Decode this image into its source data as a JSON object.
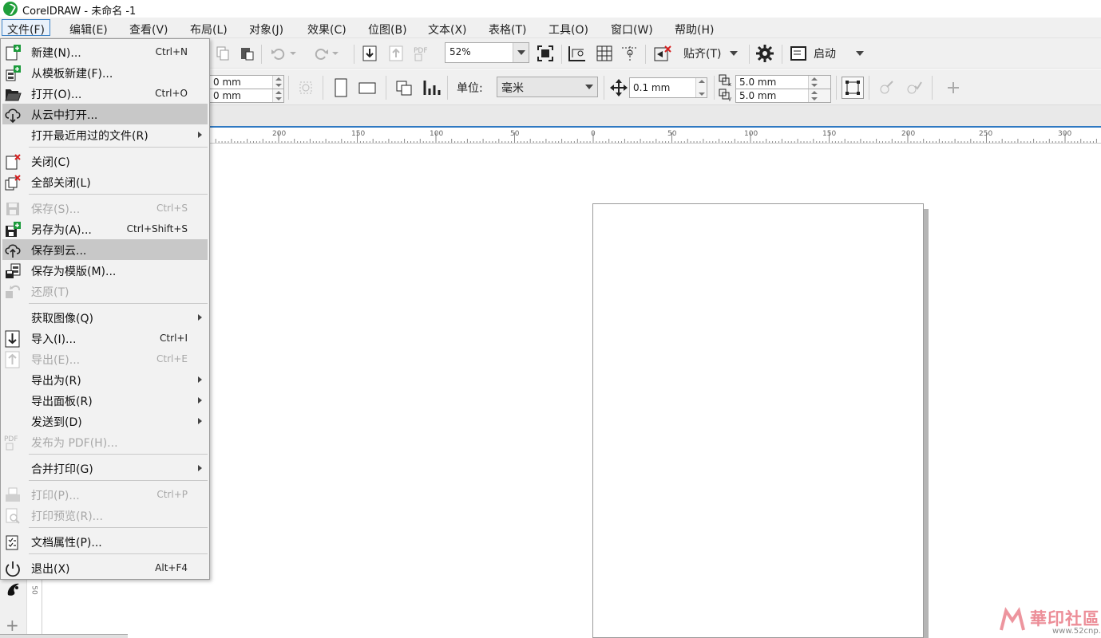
{
  "window": {
    "title": "CorelDRAW - 未命名 -1"
  },
  "menubar": {
    "items": [
      {
        "label": "文件(F)"
      },
      {
        "label": "编辑(E)"
      },
      {
        "label": "查看(V)"
      },
      {
        "label": "布局(L)"
      },
      {
        "label": "对象(J)"
      },
      {
        "label": "效果(C)"
      },
      {
        "label": "位图(B)"
      },
      {
        "label": "文本(X)"
      },
      {
        "label": "表格(T)"
      },
      {
        "label": "工具(O)"
      },
      {
        "label": "窗口(W)"
      },
      {
        "label": "帮助(H)"
      }
    ],
    "open_menu": "文件(F)"
  },
  "file_menu": {
    "items": [
      {
        "label": "新建(N)...",
        "shortcut": "Ctrl+N",
        "icon": "new-document-icon",
        "enabled": true
      },
      {
        "label": "从模板新建(F)...",
        "shortcut": "",
        "icon": "new-from-template-icon",
        "enabled": true
      },
      {
        "label": "打开(O)...",
        "shortcut": "Ctrl+O",
        "icon": "open-folder-icon",
        "enabled": true
      },
      {
        "label": "从云中打开...",
        "shortcut": "",
        "icon": "cloud-download-icon",
        "enabled": true,
        "highlighted": true
      },
      {
        "label": "打开最近用过的文件(R)",
        "shortcut": "",
        "icon": "",
        "enabled": true,
        "submenu": true
      },
      {
        "label": "关闭(C)",
        "shortcut": "",
        "icon": "close-document-icon",
        "enabled": true
      },
      {
        "label": "全部关闭(L)",
        "shortcut": "",
        "icon": "close-all-icon",
        "enabled": true
      },
      {
        "label": "保存(S)...",
        "shortcut": "Ctrl+S",
        "icon": "save-icon",
        "enabled": false
      },
      {
        "label": "另存为(A)...",
        "shortcut": "Ctrl+Shift+S",
        "icon": "save-as-icon",
        "enabled": true
      },
      {
        "label": "保存到云...",
        "shortcut": "",
        "icon": "cloud-upload-icon",
        "enabled": true,
        "highlighted": true
      },
      {
        "label": "保存为模版(M)...",
        "shortcut": "",
        "icon": "save-as-template-icon",
        "enabled": true
      },
      {
        "label": "还原(T)",
        "shortcut": "",
        "icon": "revert-icon",
        "enabled": false
      },
      {
        "label": "获取图像(Q)",
        "shortcut": "",
        "icon": "",
        "enabled": true,
        "submenu": true
      },
      {
        "label": "导入(I)...",
        "shortcut": "Ctrl+I",
        "icon": "import-icon",
        "enabled": true
      },
      {
        "label": "导出(E)...",
        "shortcut": "Ctrl+E",
        "icon": "export-icon",
        "enabled": false
      },
      {
        "label": "导出为(R)",
        "shortcut": "",
        "icon": "",
        "enabled": true,
        "submenu": true
      },
      {
        "label": "导出面板(R)",
        "shortcut": "",
        "icon": "",
        "enabled": true,
        "submenu": true
      },
      {
        "label": "发送到(D)",
        "shortcut": "",
        "icon": "",
        "enabled": true,
        "submenu": true
      },
      {
        "label": "发布为 PDF(H)...",
        "shortcut": "",
        "icon": "pdf-icon",
        "enabled": false
      },
      {
        "label": "合并打印(G)",
        "shortcut": "",
        "icon": "",
        "enabled": true,
        "submenu": true
      },
      {
        "label": "打印(P)...",
        "shortcut": "Ctrl+P",
        "icon": "print-icon",
        "enabled": false
      },
      {
        "label": "打印预览(R)...",
        "shortcut": "",
        "icon": "print-preview-icon",
        "enabled": false
      },
      {
        "label": "文档属性(P)...",
        "shortcut": "",
        "icon": "document-properties-icon",
        "enabled": true
      },
      {
        "label": "退出(X)",
        "shortcut": "Alt+F4",
        "icon": "power-icon",
        "enabled": true
      }
    ]
  },
  "toolbar": {
    "zoom": "52%",
    "snap_label": "贴齐(T)",
    "launch_label": "启动"
  },
  "propertybar": {
    "width_value": "0 mm",
    "height_value": "0 mm",
    "units_label": "单位:",
    "units_value": "毫米",
    "nudge_value": "0.1 mm",
    "dup_x": "5.0 mm",
    "dup_y": "5.0 mm"
  },
  "ruler": {
    "labels": [
      "200",
      "150",
      "100",
      "50",
      "0",
      "50",
      "100",
      "150",
      "200",
      "250",
      "300"
    ]
  },
  "vruler": {
    "label": "50"
  },
  "watermark": {
    "text": "華印社區",
    "url": "www.52cnp.com"
  },
  "colors": {
    "accent": "#2f79c2",
    "highlight": "#c8c8c8",
    "logo": "#1f9e3a"
  }
}
